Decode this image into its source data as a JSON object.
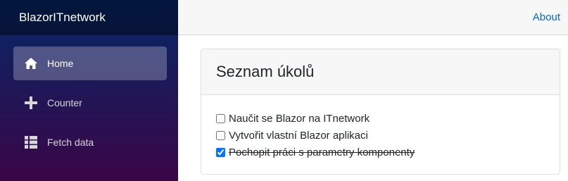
{
  "sidebar": {
    "brand": "BlazorITnetwork",
    "items": [
      {
        "label": "Home",
        "icon": "home-icon",
        "active": true
      },
      {
        "label": "Counter",
        "icon": "plus-icon",
        "active": false
      },
      {
        "label": "Fetch data",
        "icon": "list-icon",
        "active": false
      }
    ]
  },
  "topbar": {
    "about_label": "About"
  },
  "main": {
    "title": "Seznam úkolů",
    "tasks": [
      {
        "label": "Naučit se Blazor na ITnetwork",
        "done": false
      },
      {
        "label": "Vytvořit vlastní Blazor aplikaci",
        "done": false
      },
      {
        "label": "Pochopit práci s parametry komponenty",
        "done": true
      }
    ]
  },
  "colors": {
    "accent": "#0366d6",
    "sidebar_top": "#052767",
    "sidebar_bottom": "#3a0647"
  }
}
